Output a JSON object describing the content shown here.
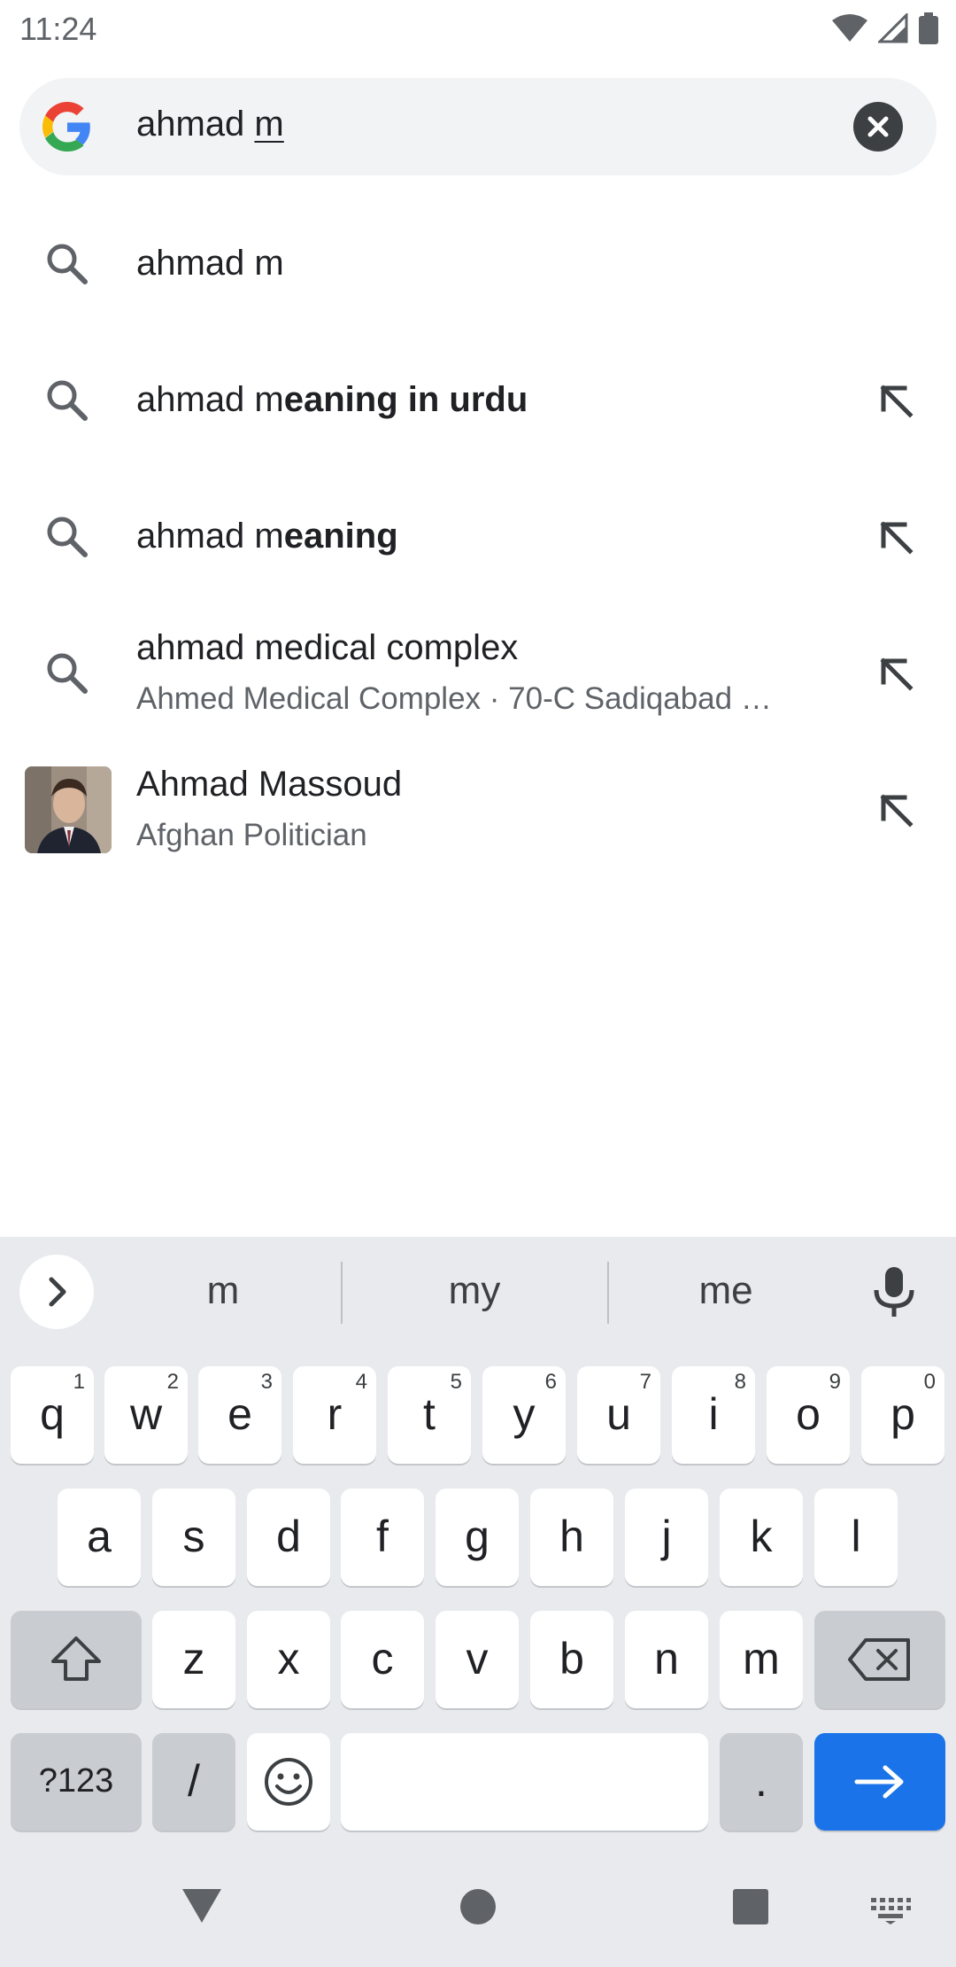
{
  "status_bar": {
    "time": "11:24",
    "icons": [
      "wifi-icon",
      "signal-icon",
      "battery-icon"
    ]
  },
  "search": {
    "typed_prefix": "ahmad ",
    "typed_composing": "m",
    "clear_icon": "close-icon",
    "logo": "google-g-logo"
  },
  "suggestions": [
    {
      "prefix": "ahmad m",
      "bold": "",
      "subtitle": "",
      "icon": "search-icon",
      "has_arrow": false
    },
    {
      "prefix": "ahmad m",
      "bold": "eaning in urdu",
      "subtitle": "",
      "icon": "search-icon",
      "has_arrow": true
    },
    {
      "prefix": "ahmad m",
      "bold": "eaning",
      "subtitle": "",
      "icon": "search-icon",
      "has_arrow": true
    },
    {
      "prefix": "ahmad medical complex",
      "bold": "",
      "subtitle": "Ahmed Medical Complex · 70-C Sadiqabad …",
      "icon": "search-icon",
      "has_arrow": true
    },
    {
      "prefix": "Ahmad Massoud",
      "bold": "",
      "subtitle": "Afghan Politician",
      "icon": "avatar",
      "has_arrow": true
    }
  ],
  "keyboard": {
    "word_suggestions": [
      "m",
      "my",
      "me"
    ],
    "row1": [
      {
        "k": "q",
        "h": "1"
      },
      {
        "k": "w",
        "h": "2"
      },
      {
        "k": "e",
        "h": "3"
      },
      {
        "k": "r",
        "h": "4"
      },
      {
        "k": "t",
        "h": "5"
      },
      {
        "k": "y",
        "h": "6"
      },
      {
        "k": "u",
        "h": "7"
      },
      {
        "k": "i",
        "h": "8"
      },
      {
        "k": "o",
        "h": "9"
      },
      {
        "k": "p",
        "h": "0"
      }
    ],
    "row2": [
      "a",
      "s",
      "d",
      "f",
      "g",
      "h",
      "j",
      "k",
      "l"
    ],
    "row3": [
      "z",
      "x",
      "c",
      "v",
      "b",
      "n",
      "m"
    ],
    "symbols_label": "?123",
    "slash_label": "/",
    "period_label": ".",
    "accent_color": "#1a73e8"
  }
}
